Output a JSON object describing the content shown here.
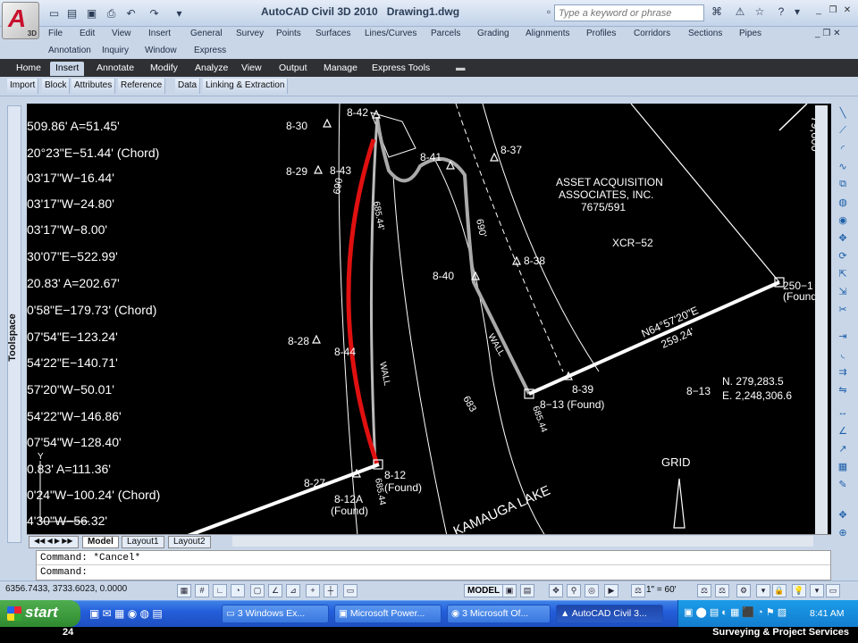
{
  "app": {
    "title": "AutoCAD Civil 3D 2010",
    "file": "Drawing1.dwg",
    "logo_letter": "A",
    "logo_sub": "3D"
  },
  "search": {
    "placeholder": "Type a keyword or phrase"
  },
  "menus": [
    "File",
    "Edit",
    "View",
    "Insert",
    "General",
    "Survey",
    "Points",
    "Surfaces",
    "Lines/Curves",
    "Parcels",
    "Grading",
    "Alignments",
    "Profiles",
    "Corridors",
    "Sections",
    "Pipes",
    "Annotation",
    "Inquiry",
    "Window",
    "Express"
  ],
  "ribbon_tabs": [
    "Home",
    "Insert",
    "Annotate",
    "Modify",
    "Analyze",
    "View",
    "Output",
    "Manage",
    "Express Tools"
  ],
  "active_ribbon_tab": "Insert",
  "panels": [
    "Import",
    "Block",
    "Attributes",
    "Reference",
    "Data",
    "Linking & Extraction"
  ],
  "left_strip": {
    "label": "Toolspace"
  },
  "bearings": [
    "509.86' A=51.45'",
    "20°23\"E−51.44' (Chord)",
    "03'17\"W−16.44'",
    "03'17\"W−24.80'",
    "03'17\"W−8.00'",
    "30'07\"E−522.99'",
    "20.83' A=202.67'",
    "0'58\"E−179.73' (Chord)",
    "07'54\"E−123.24'",
    "54'22\"E−140.71'",
    "57'20\"W−50.01'",
    "54'22\"W−146.86'",
    "07'54\"W−128.40'",
    "0.83' A=111.36'",
    "0'24\"W−100.24' (Chord)",
    "4'30\"W−56.32'"
  ],
  "stations": [
    "8-30",
    "8-42",
    "8-29",
    "8-43",
    "8-41",
    "8-37",
    "8-38",
    "8-40",
    "8-28",
    "8-44",
    "8-39",
    "8-13",
    "8-27",
    "8-12A",
    "8-12"
  ],
  "drawing_labels": {
    "owner": [
      "ASSET ACQUISITION",
      "ASSOCIATES, INC.",
      "7675/591"
    ],
    "xcr": "XCR−52",
    "pt250": "250−1",
    "found": "(Found)",
    "bearing": "N64°57'20\"E",
    "distance": "259.24'",
    "coord_label": "8−13",
    "north": "N. 279,283.5",
    "east": "E. 2,248,306.6",
    "grid": "GRID",
    "lake": "KAMAUGA LAKE",
    "wall": "WALL",
    "elev": "685.44'",
    "elev2": "685.44",
    "c690": "690'",
    "c690b": "690",
    "c683": "683",
    "st_8_13_found": "8−13 (Found)",
    "st_8_12_found": "(Found)",
    "st_8_12a_found": "(Found)",
    "edge_text": "79,600"
  },
  "layout_tabs": [
    "Model",
    "Layout1",
    "Layout2"
  ],
  "command_lines": [
    "Command: *Cancel*",
    "Command:"
  ],
  "status": {
    "coords": "6356.7433, 3733.6023, 0.0000",
    "model": "MODEL",
    "scale": "1\" = 60'"
  },
  "taskbar": {
    "start": "start",
    "tasks": [
      "3 Windows Ex...",
      "Microsoft Power...",
      "3 Microsoft Of...",
      "AutoCAD Civil 3..."
    ],
    "clock": "8:41 AM"
  },
  "footer": {
    "page": "24",
    "title": "Surveying & Project Services"
  }
}
